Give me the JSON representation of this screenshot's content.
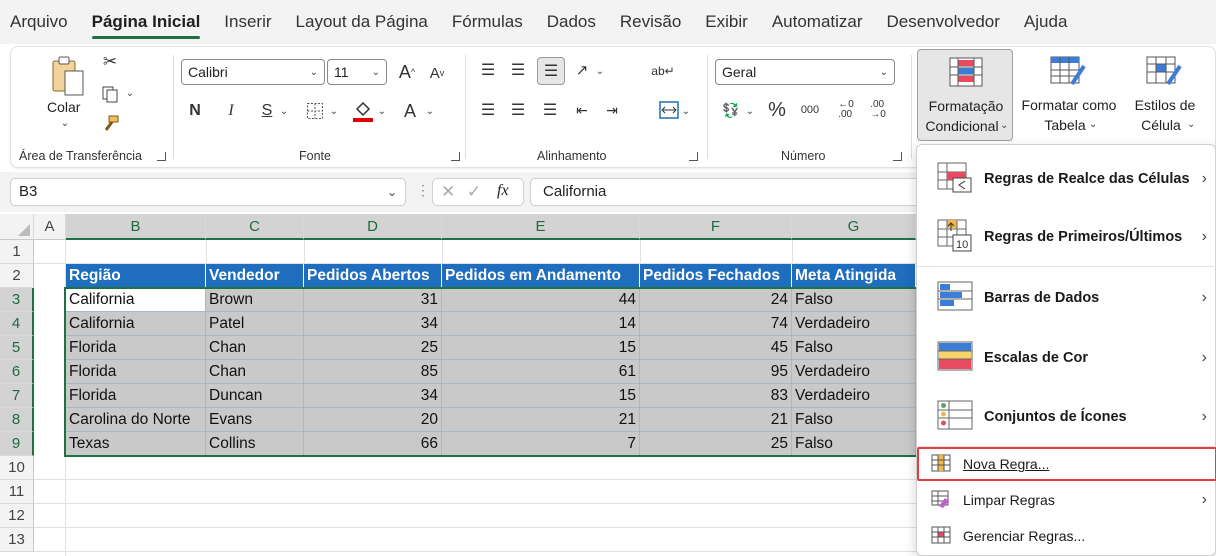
{
  "tabs": [
    "Arquivo",
    "Página Inicial",
    "Inserir",
    "Layout da Página",
    "Fórmulas",
    "Dados",
    "Revisão",
    "Exibir",
    "Automatizar",
    "Desenvolvedor",
    "Ajuda"
  ],
  "active_tab": "Página Inicial",
  "ribbon": {
    "clipboard": {
      "paste_label": "Colar",
      "group_label": "Área de Transferência"
    },
    "font": {
      "font_name": "Calibri",
      "font_size": "11",
      "bold": "N",
      "italic": "I",
      "underline": "S",
      "group_label": "Fonte"
    },
    "alignment": {
      "group_label": "Alinhamento"
    },
    "number": {
      "format": "Geral",
      "percent": "%",
      "thousands": "000",
      "group_label": "Número"
    },
    "styles": {
      "conditional_line1": "Formatação",
      "conditional_line2": "Condicional",
      "table_line1": "Formatar como",
      "table_line2": "Tabela",
      "cellstyles_line1": "Estilos de",
      "cellstyles_line2": "Célula"
    }
  },
  "formula_bar": {
    "name_box": "B3",
    "fx": "fx",
    "formula": "California"
  },
  "columns": [
    "A",
    "B",
    "C",
    "D",
    "E",
    "F",
    "G"
  ],
  "rows": [
    "1",
    "2",
    "3",
    "4",
    "5",
    "6",
    "7",
    "8",
    "9",
    "10",
    "11",
    "12",
    "13"
  ],
  "table": {
    "headers": [
      "Região",
      "Vendedor",
      "Pedidos Abertos",
      "Pedidos em Andamento",
      "Pedidos Fechados",
      "Meta Atingida"
    ],
    "rows": [
      [
        "California",
        "Brown",
        "31",
        "44",
        "24",
        "Falso"
      ],
      [
        "California",
        "Patel",
        "34",
        "14",
        "74",
        "Verdadeiro"
      ],
      [
        "Florida",
        "Chan",
        "25",
        "15",
        "45",
        "Falso"
      ],
      [
        "Florida",
        "Chan",
        "85",
        "61",
        "95",
        "Verdadeiro"
      ],
      [
        "Florida",
        "Duncan",
        "34",
        "15",
        "83",
        "Verdadeiro"
      ],
      [
        "Carolina do Norte",
        "Evans",
        "20",
        "21",
        "21",
        "Falso"
      ],
      [
        "Texas",
        "Collins",
        "66",
        "7",
        "25",
        "Falso"
      ]
    ]
  },
  "menu": {
    "items": [
      {
        "label": "Regras de Realce das Células",
        "icon": "highlight-rules-icon"
      },
      {
        "label": "Regras de Primeiros/Últimos",
        "icon": "top-bottom-icon"
      },
      {
        "label": "Barras de Dados",
        "icon": "data-bars-icon"
      },
      {
        "label": "Escalas de Cor",
        "icon": "color-scales-icon"
      },
      {
        "label": "Conjuntos de Ícones",
        "icon": "icon-sets-icon"
      },
      {
        "label": "Nova Regra...",
        "icon": "new-rule-icon"
      },
      {
        "label": "Limpar Regras",
        "icon": "clear-rules-icon"
      },
      {
        "label": "Gerenciar Regras...",
        "icon": "manage-rules-icon"
      }
    ]
  },
  "colors": {
    "accent": "#1e7145",
    "table_header": "#1f6dbf",
    "highlight_box": "#e04040"
  }
}
